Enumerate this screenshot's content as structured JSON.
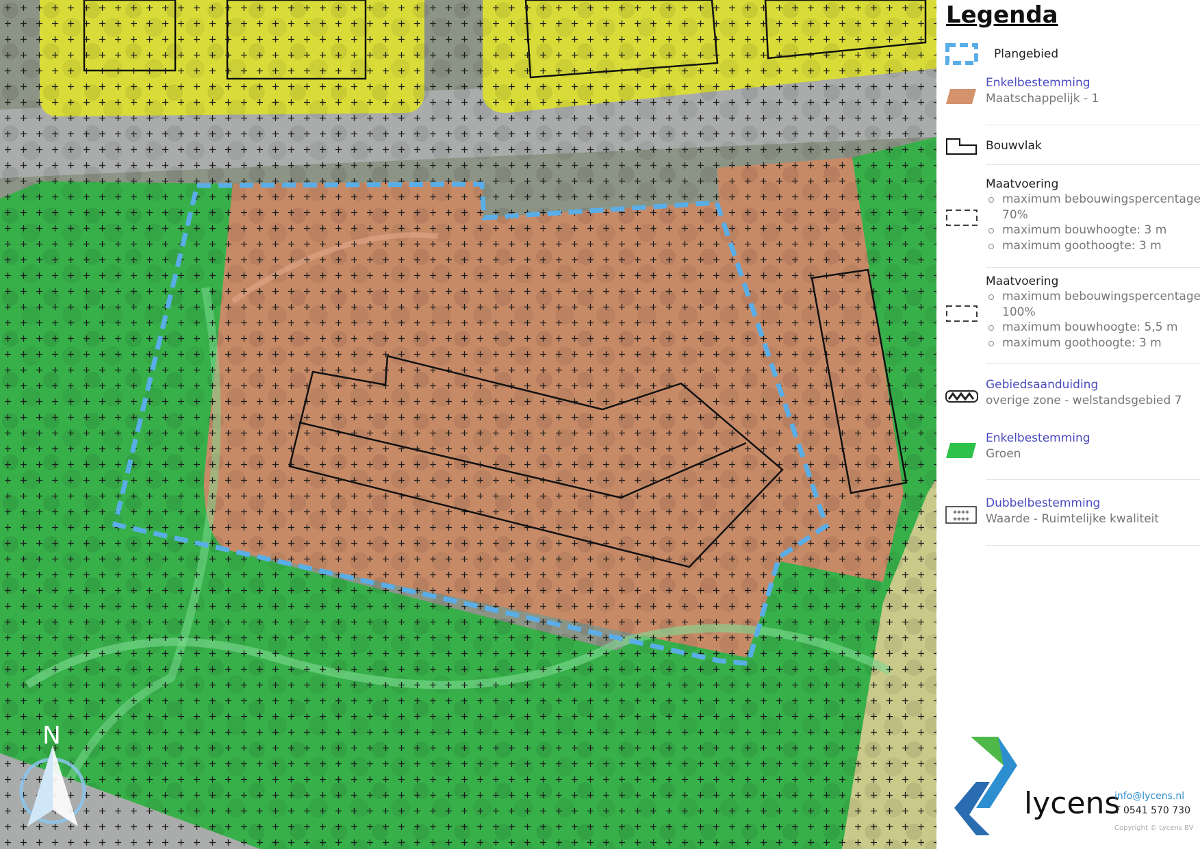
{
  "legend": {
    "title": "Legenda",
    "items": [
      {
        "heading": "Plangebied"
      },
      {
        "heading": "Enkelbestemming",
        "sub": "Maatschappelijk - 1"
      },
      {
        "heading": "Bouwvlak"
      },
      {
        "heading": "Maatvoering",
        "bullets": [
          "maximum bebouwingspercentage: 70%",
          "maximum bouwhoogte: 3 m",
          "maximum goothoogte: 3 m"
        ]
      },
      {
        "heading": "Maatvoering",
        "bullets": [
          "maximum bebouwingspercentage: 100%",
          "maximum bouwhoogte: 5,5 m",
          "maximum goothoogte: 3 m"
        ]
      },
      {
        "heading": "Gebiedsaanduiding",
        "sub": "overige zone - welstandsgebied 7"
      },
      {
        "heading": "Enkelbestemming",
        "sub": "Groen"
      },
      {
        "heading": "Dubbelbestemming",
        "sub": "Waarde - Ruimtelijke kwaliteit"
      }
    ]
  },
  "brand": {
    "name": "lycens",
    "email": "info@lycens.nl",
    "phone": "T 0541 570 730",
    "copyright": "Copyright © Lycens BV"
  },
  "north_label": "N",
  "colors": {
    "plangebied": "#5aaee8",
    "maatschappelijk": "#d4936c",
    "groen": "#2ec24a",
    "wonen": "#f2f21c",
    "bouwvlak": "#111111",
    "heading": "#4a4ac0"
  }
}
